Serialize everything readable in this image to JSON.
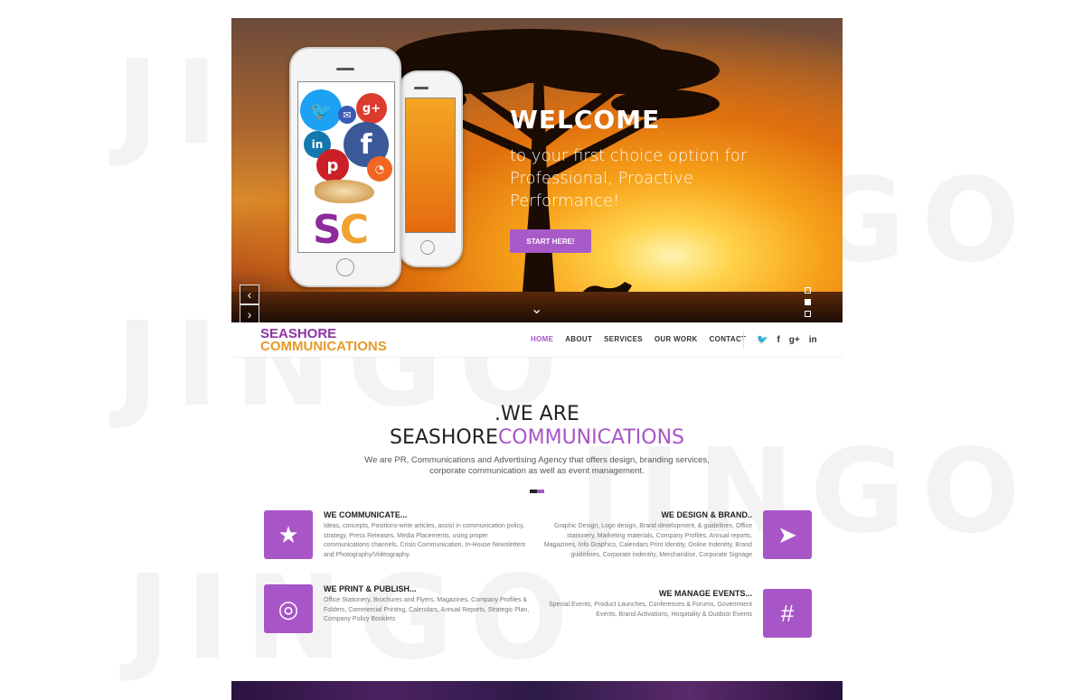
{
  "watermark": "JINGO",
  "hero": {
    "welcome": "WELCOME",
    "tagline": "to your first choice option for Professional, Proactive Performance!",
    "cta": "START HERE!",
    "app_letters": {
      "s": "S",
      "c": "C"
    },
    "slide_index": 2,
    "slide_count": 3
  },
  "nav": {
    "logo_line1": "SEASHORE",
    "logo_line2": "COMMUNICATIONS",
    "items": [
      "HOME",
      "ABOUT",
      "SERVICES",
      "OUR WORK",
      "CONTACT"
    ],
    "active": "HOME",
    "social": [
      "twitter-icon",
      "facebook-icon",
      "google-plus-icon",
      "linkedin-icon"
    ]
  },
  "about": {
    "line1": ".WE ARE",
    "line2_dark": "SEASHORE",
    "line2_purple": "COMMUNICATIONS",
    "description": "We are PR, Communications and Advertising Agency that offers design, branding services, corporate communication as well as event management."
  },
  "services": [
    {
      "title": "WE COMMUNICATE...",
      "text": "Ideas, concepts, Positions-write articles, assist in communication policy, strategy, Press Releases, Media Placements, using proper communications channels, Crisis Communication, In-House Newsletters and Photography/Videography.",
      "icon": "star-icon"
    },
    {
      "title": "WE DESIGN & BRAND..",
      "text": "Graphic Design, Logo design, Brand development, & guidelines, Office stationery, Marketing materials, Company Profiles, Annual reports, Magazines, Info Graphics, Calendars Print Identity, Online Indentity, Brand guidelines, Corporate indentity, Merchandise, Corporate Signage",
      "icon": "paper-plane-icon"
    },
    {
      "title": "WE PRINT & PUBLISH...",
      "text": "Office Stationery, Brochures and Flyers, Magazines, Company Profiles & Folders, Commercial Printing, Calendars, Annual Reports, Strategic Plan, Company Policy Booklets",
      "icon": "life-ring-icon"
    },
    {
      "title": "WE MANAGE EVENTS...",
      "text": "Special Events, Product Launches, Conferences & Forums, Government Events, Brand Activations, Hospitality & Outdoor Events",
      "icon": "hashtag-icon"
    }
  ],
  "colors": {
    "accent": "#a855c7",
    "logo_purple": "#8b35a0",
    "logo_orange": "#e69a2a"
  }
}
